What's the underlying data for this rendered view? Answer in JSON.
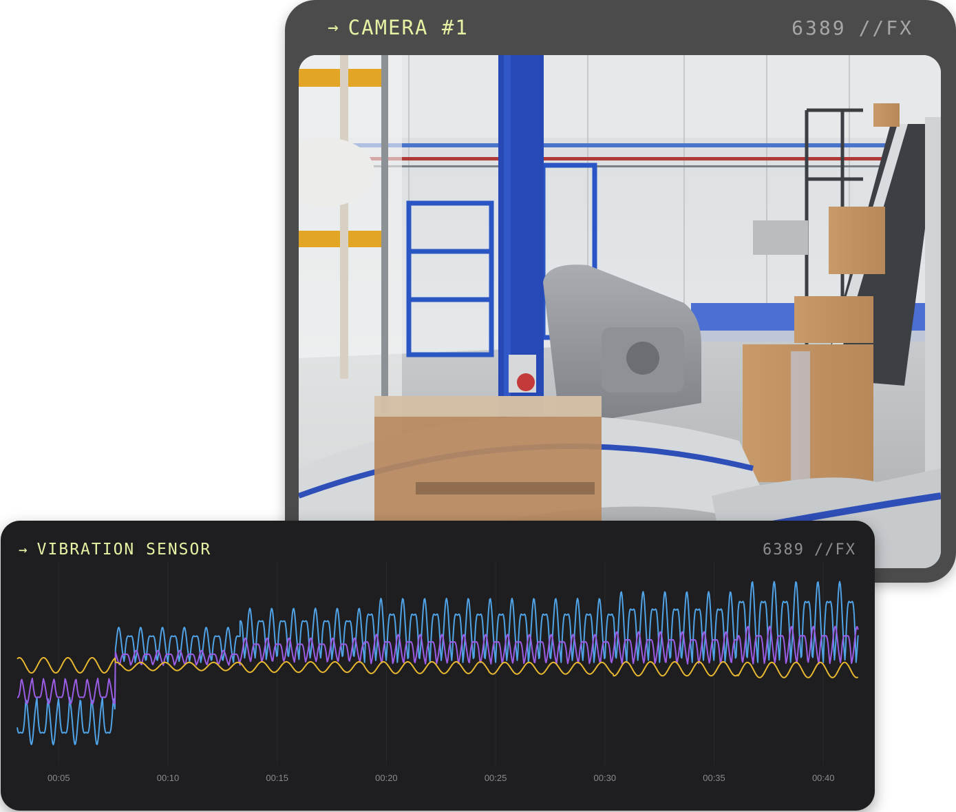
{
  "camera": {
    "arrow": "→",
    "title": "CAMERA #1",
    "id": "6389",
    "suffix": "//FX"
  },
  "sensor": {
    "arrow": "→",
    "title": "VIBRATION SENSOR",
    "id": "6389",
    "suffix": "//FX"
  },
  "colors": {
    "accent": "#e8f1a4",
    "camera_card": "#4b4b4b",
    "sensor_card": "#1e1e20",
    "series_blue": "#4fa3e6",
    "series_purple": "#9b5de5",
    "series_yellow": "#e8b830"
  },
  "chart_data": {
    "type": "line",
    "title": "",
    "xlabel": "",
    "ylabel": "",
    "x_ticks": [
      "00:05",
      "00:10",
      "00:15",
      "00:20",
      "00:25",
      "00:30",
      "00:35",
      "00:40"
    ],
    "x_range_seconds": [
      3.1,
      41.6
    ],
    "grid": "vertical",
    "series": [
      {
        "color": "#4fa3e6",
        "segments": [
          [
            3.1,
            7.6,
            -0.7,
            -0.55
          ],
          [
            7.6,
            13.3,
            0.52,
            0.05
          ],
          [
            13.3,
            19.0,
            0.76,
            0.1
          ],
          [
            19.0,
            24.7,
            0.95,
            0.05
          ],
          [
            24.7,
            30.4,
            0.95,
            0.05
          ],
          [
            30.4,
            36.1,
            1.05,
            0.05
          ],
          [
            36.1,
            41.6,
            1.2,
            0.05
          ]
        ]
      },
      {
        "color": "#9b5de5",
        "segments": [
          [
            3.1,
            7.6,
            -0.38,
            -0.22
          ],
          [
            7.6,
            13.3,
            0.22,
            0.0
          ],
          [
            13.3,
            19.0,
            0.36,
            0.05
          ],
          [
            19.0,
            24.7,
            0.44,
            0.02
          ],
          [
            24.7,
            30.4,
            0.44,
            0.02
          ],
          [
            30.4,
            36.1,
            0.48,
            0.02
          ],
          [
            36.1,
            41.6,
            0.56,
            0.02
          ]
        ]
      },
      {
        "color": "#e8b830",
        "segments": [
          [
            3.1,
            7.6,
            0.13,
            0.0
          ],
          [
            7.6,
            13.3,
            0.07,
            -0.02
          ],
          [
            13.3,
            19.0,
            0.09,
            -0.03
          ],
          [
            19.0,
            24.7,
            0.1,
            -0.04
          ],
          [
            24.7,
            30.4,
            0.1,
            -0.05
          ],
          [
            30.4,
            36.1,
            0.12,
            -0.06
          ],
          [
            36.1,
            41.6,
            0.13,
            -0.08
          ]
        ]
      }
    ]
  }
}
